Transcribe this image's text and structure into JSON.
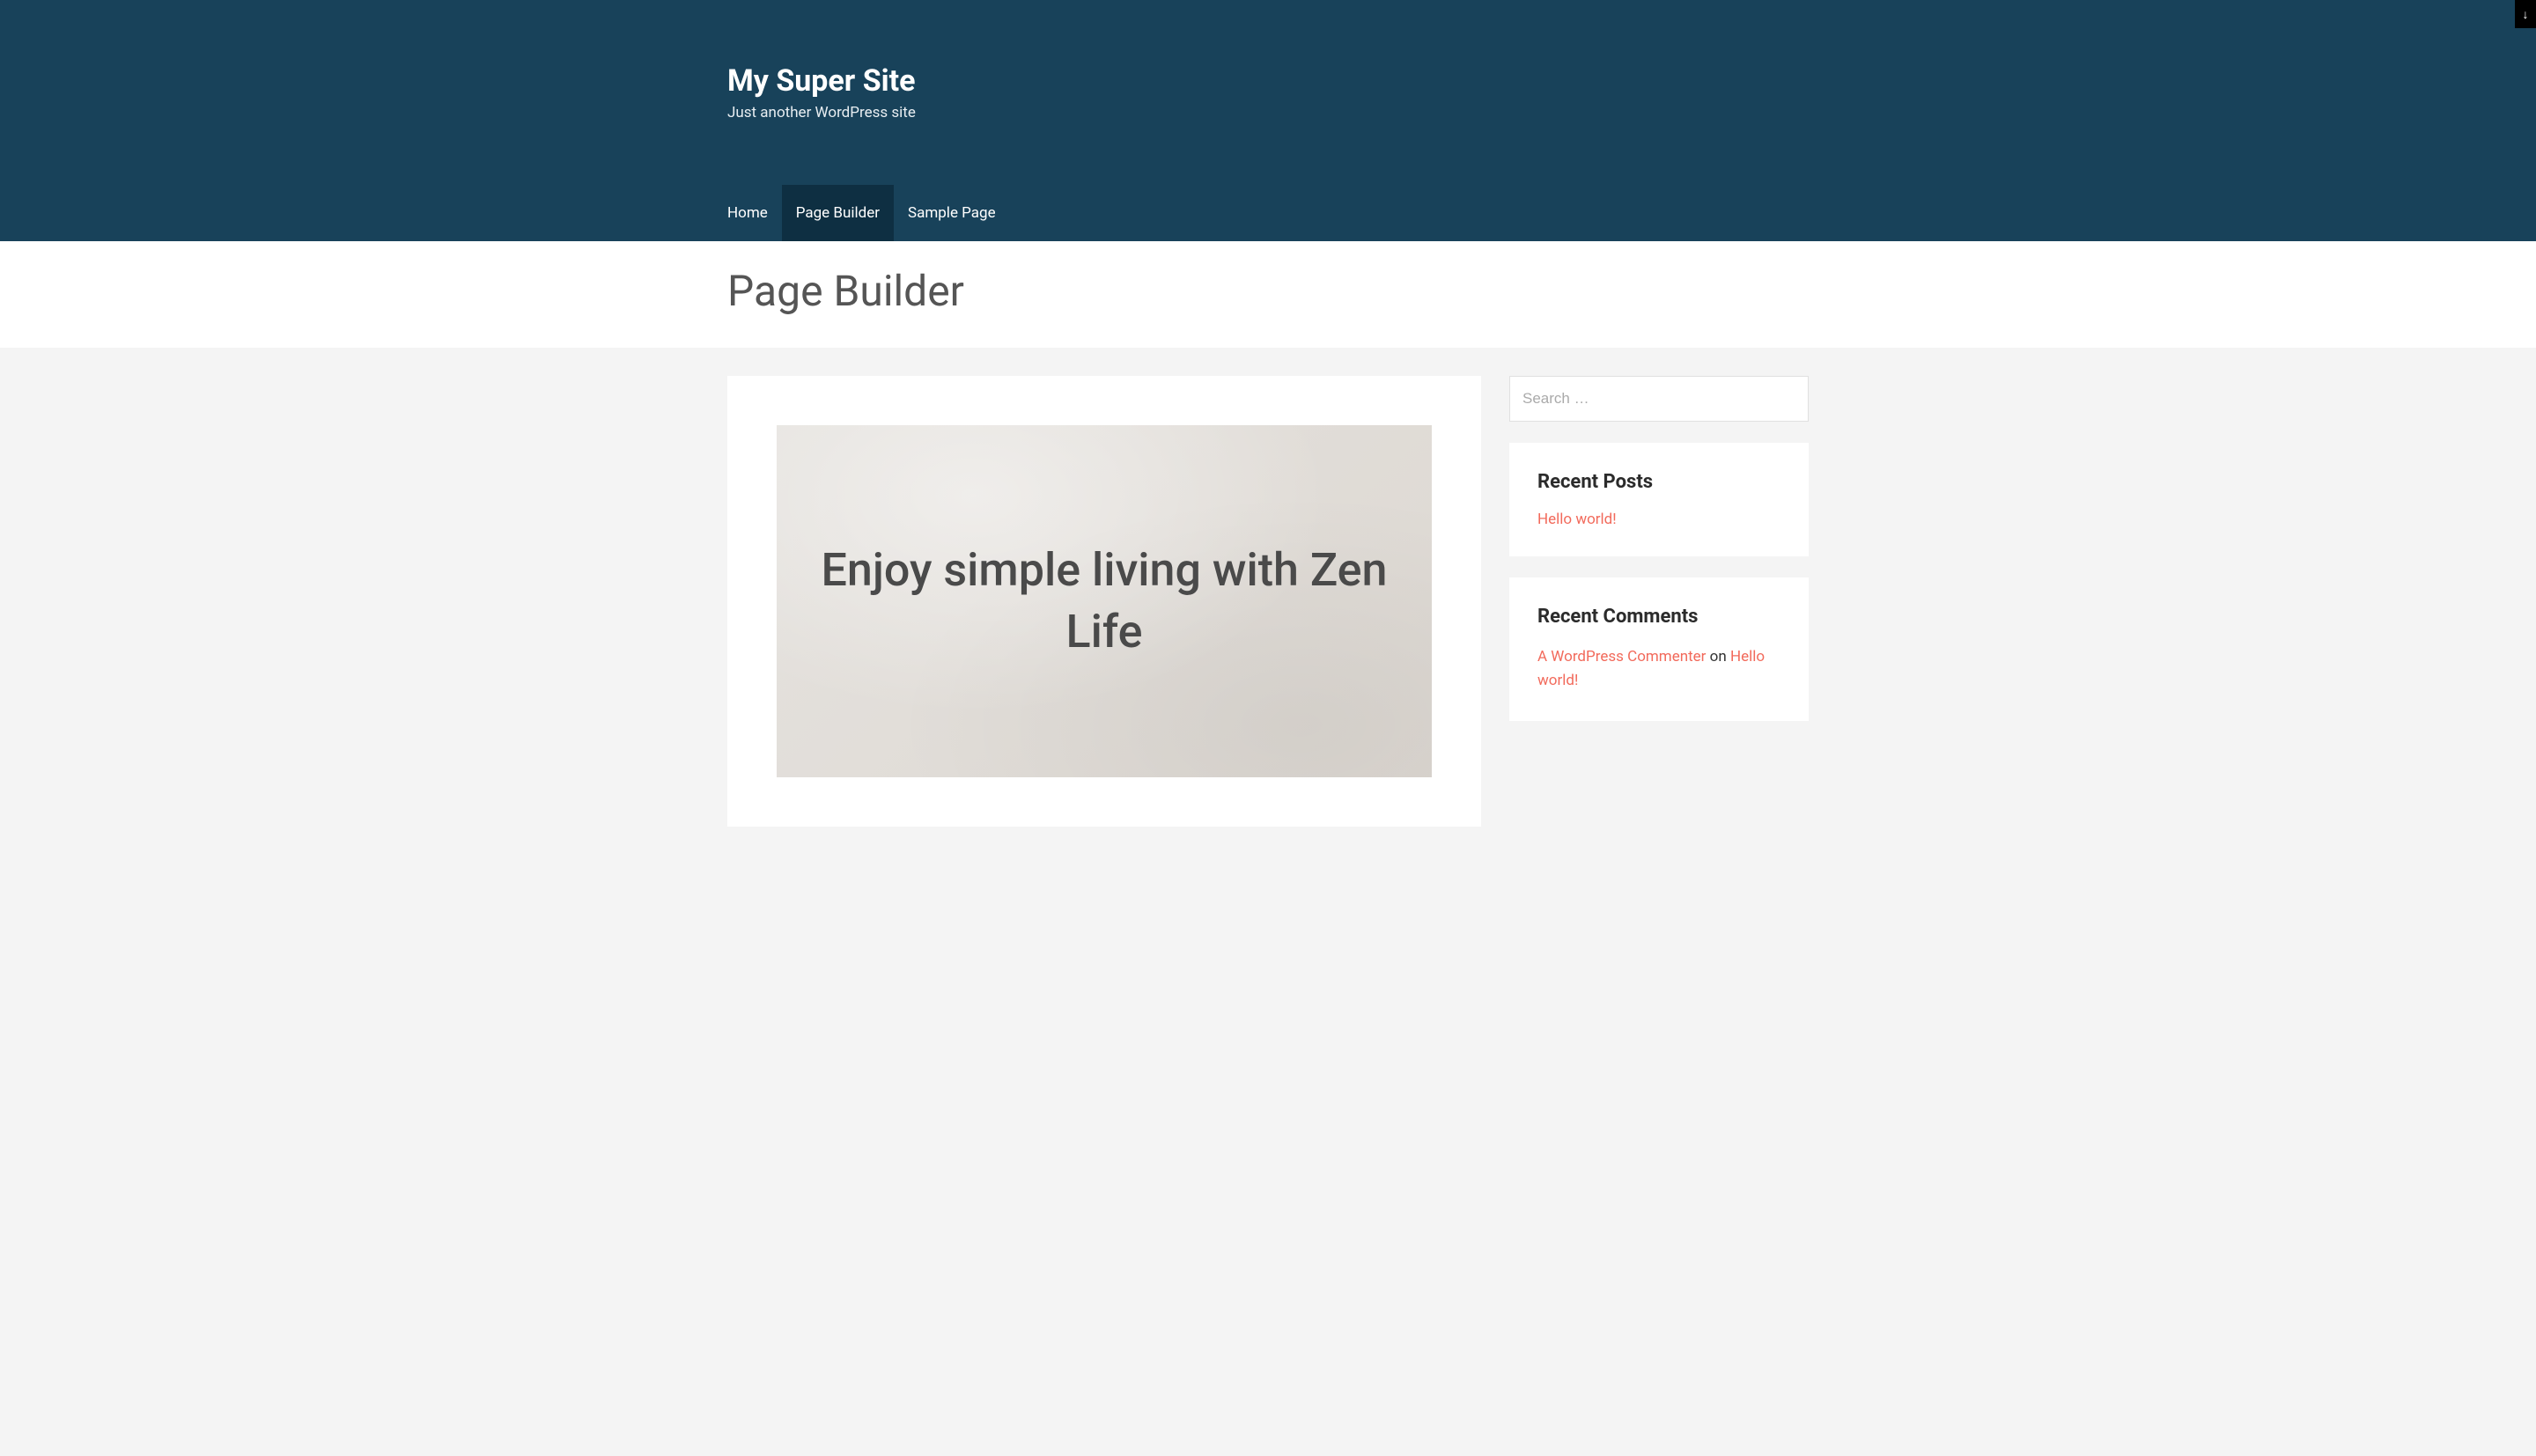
{
  "header": {
    "site_title": "My Super Site",
    "tagline": "Just another WordPress site",
    "nav": [
      {
        "label": "Home",
        "active": false
      },
      {
        "label": "Page Builder",
        "active": true
      },
      {
        "label": "Sample Page",
        "active": false
      }
    ]
  },
  "page": {
    "title": "Page Builder"
  },
  "content": {
    "hero_text": "Enjoy simple living with Zen Life"
  },
  "sidebar": {
    "search": {
      "placeholder": "Search …",
      "value": ""
    },
    "recent_posts": {
      "title": "Recent Posts",
      "items": [
        {
          "label": "Hello world!"
        }
      ]
    },
    "recent_comments": {
      "title": "Recent Comments",
      "items": [
        {
          "author": "A WordPress Commenter",
          "sep": " on ",
          "post": "Hello world!"
        }
      ]
    }
  },
  "scroll_btn": "↓"
}
